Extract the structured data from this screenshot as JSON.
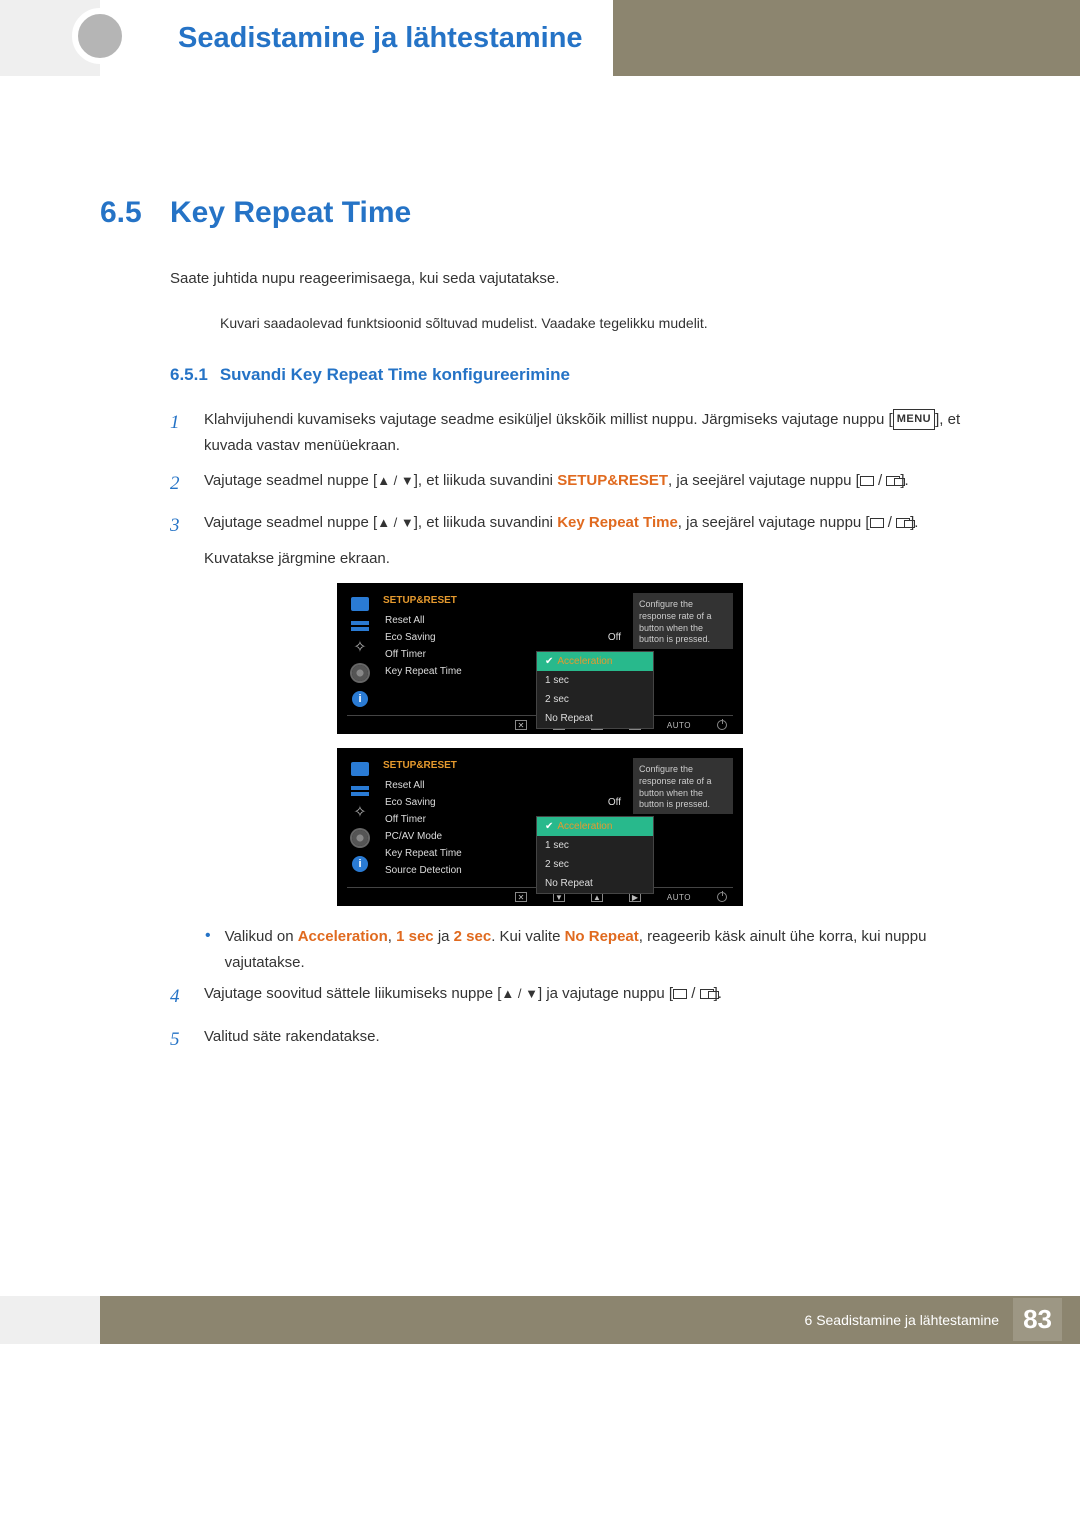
{
  "header": {
    "chapter_title": "Seadistamine ja lähtestamine"
  },
  "section": {
    "number": "6.5",
    "title": "Key Repeat Time",
    "intro": "Saate juhtida nupu reageerimisaega, kui seda vajutatakse.",
    "note": "Kuvari saadaolevad funktsioonid sõltuvad mudelist. Vaadake tegelikku mudelit."
  },
  "subsection": {
    "number": "6.5.1",
    "title": "Suvandi Key Repeat Time konfigureerimine"
  },
  "steps": {
    "s1": {
      "num": "1",
      "text_a": "Klahvijuhendi kuvamiseks vajutage seadme esiküljel ükskõik millist nuppu. Järgmiseks vajutage nuppu [",
      "menu_label": "MENU",
      "text_b": "], et kuvada vastav menüüekraan."
    },
    "s2": {
      "num": "2",
      "text_a": "Vajutage seadmel nuppe [",
      "arrows": "▲ / ▼",
      "text_b": "], et liikuda suvandini ",
      "target": "SETUP&RESET",
      "text_c": ", ja seejärel vajutage nuppu [",
      "text_d": "]."
    },
    "s3": {
      "num": "3",
      "text_a": "Vajutage seadmel nuppe [",
      "arrows": "▲ / ▼",
      "text_b": "], et liikuda suvandini ",
      "target": "Key Repeat Time",
      "text_c": ", ja seejärel vajutage nuppu [",
      "text_d": "].",
      "after": "Kuvatakse järgmine ekraan."
    },
    "bullet": {
      "text_a": "Valikud on ",
      "opt1": "Acceleration",
      "sep1": ", ",
      "opt2": "1 sec",
      "sep2": " ja ",
      "opt3": "2 sec",
      "text_b": ". Kui valite ",
      "opt4": "No Repeat",
      "text_c": ", reageerib käsk ainult ühe korra, kui nuppu vajutatakse."
    },
    "s4": {
      "num": "4",
      "text_a": "Vajutage soovitud sättele liikumiseks nuppe [",
      "arrows": "▲ / ▼",
      "text_b": "] ja vajutage nuppu [",
      "text_c": "]."
    },
    "s5": {
      "num": "5",
      "text": "Valitud säte rakendatakse."
    }
  },
  "osd": {
    "header": "SETUP&RESET",
    "desc": "Configure the response rate of a button when the button is pressed.",
    "eco_off": "Off",
    "auto": "AUTO",
    "screen1_items": [
      "Reset All",
      "Eco Saving",
      "Off Timer",
      "Key Repeat Time"
    ],
    "screen2_items": [
      "Reset All",
      "Eco Saving",
      "Off Timer",
      "PC/AV Mode",
      "Key Repeat Time",
      "Source Detection"
    ],
    "dropdown": {
      "selected": "Acceleration",
      "others": [
        "1 sec",
        "2 sec",
        "No Repeat"
      ]
    }
  },
  "footer": {
    "chapter_ref_num": "6",
    "chapter_ref_title": "Seadistamine ja lähtestamine",
    "page": "83"
  }
}
